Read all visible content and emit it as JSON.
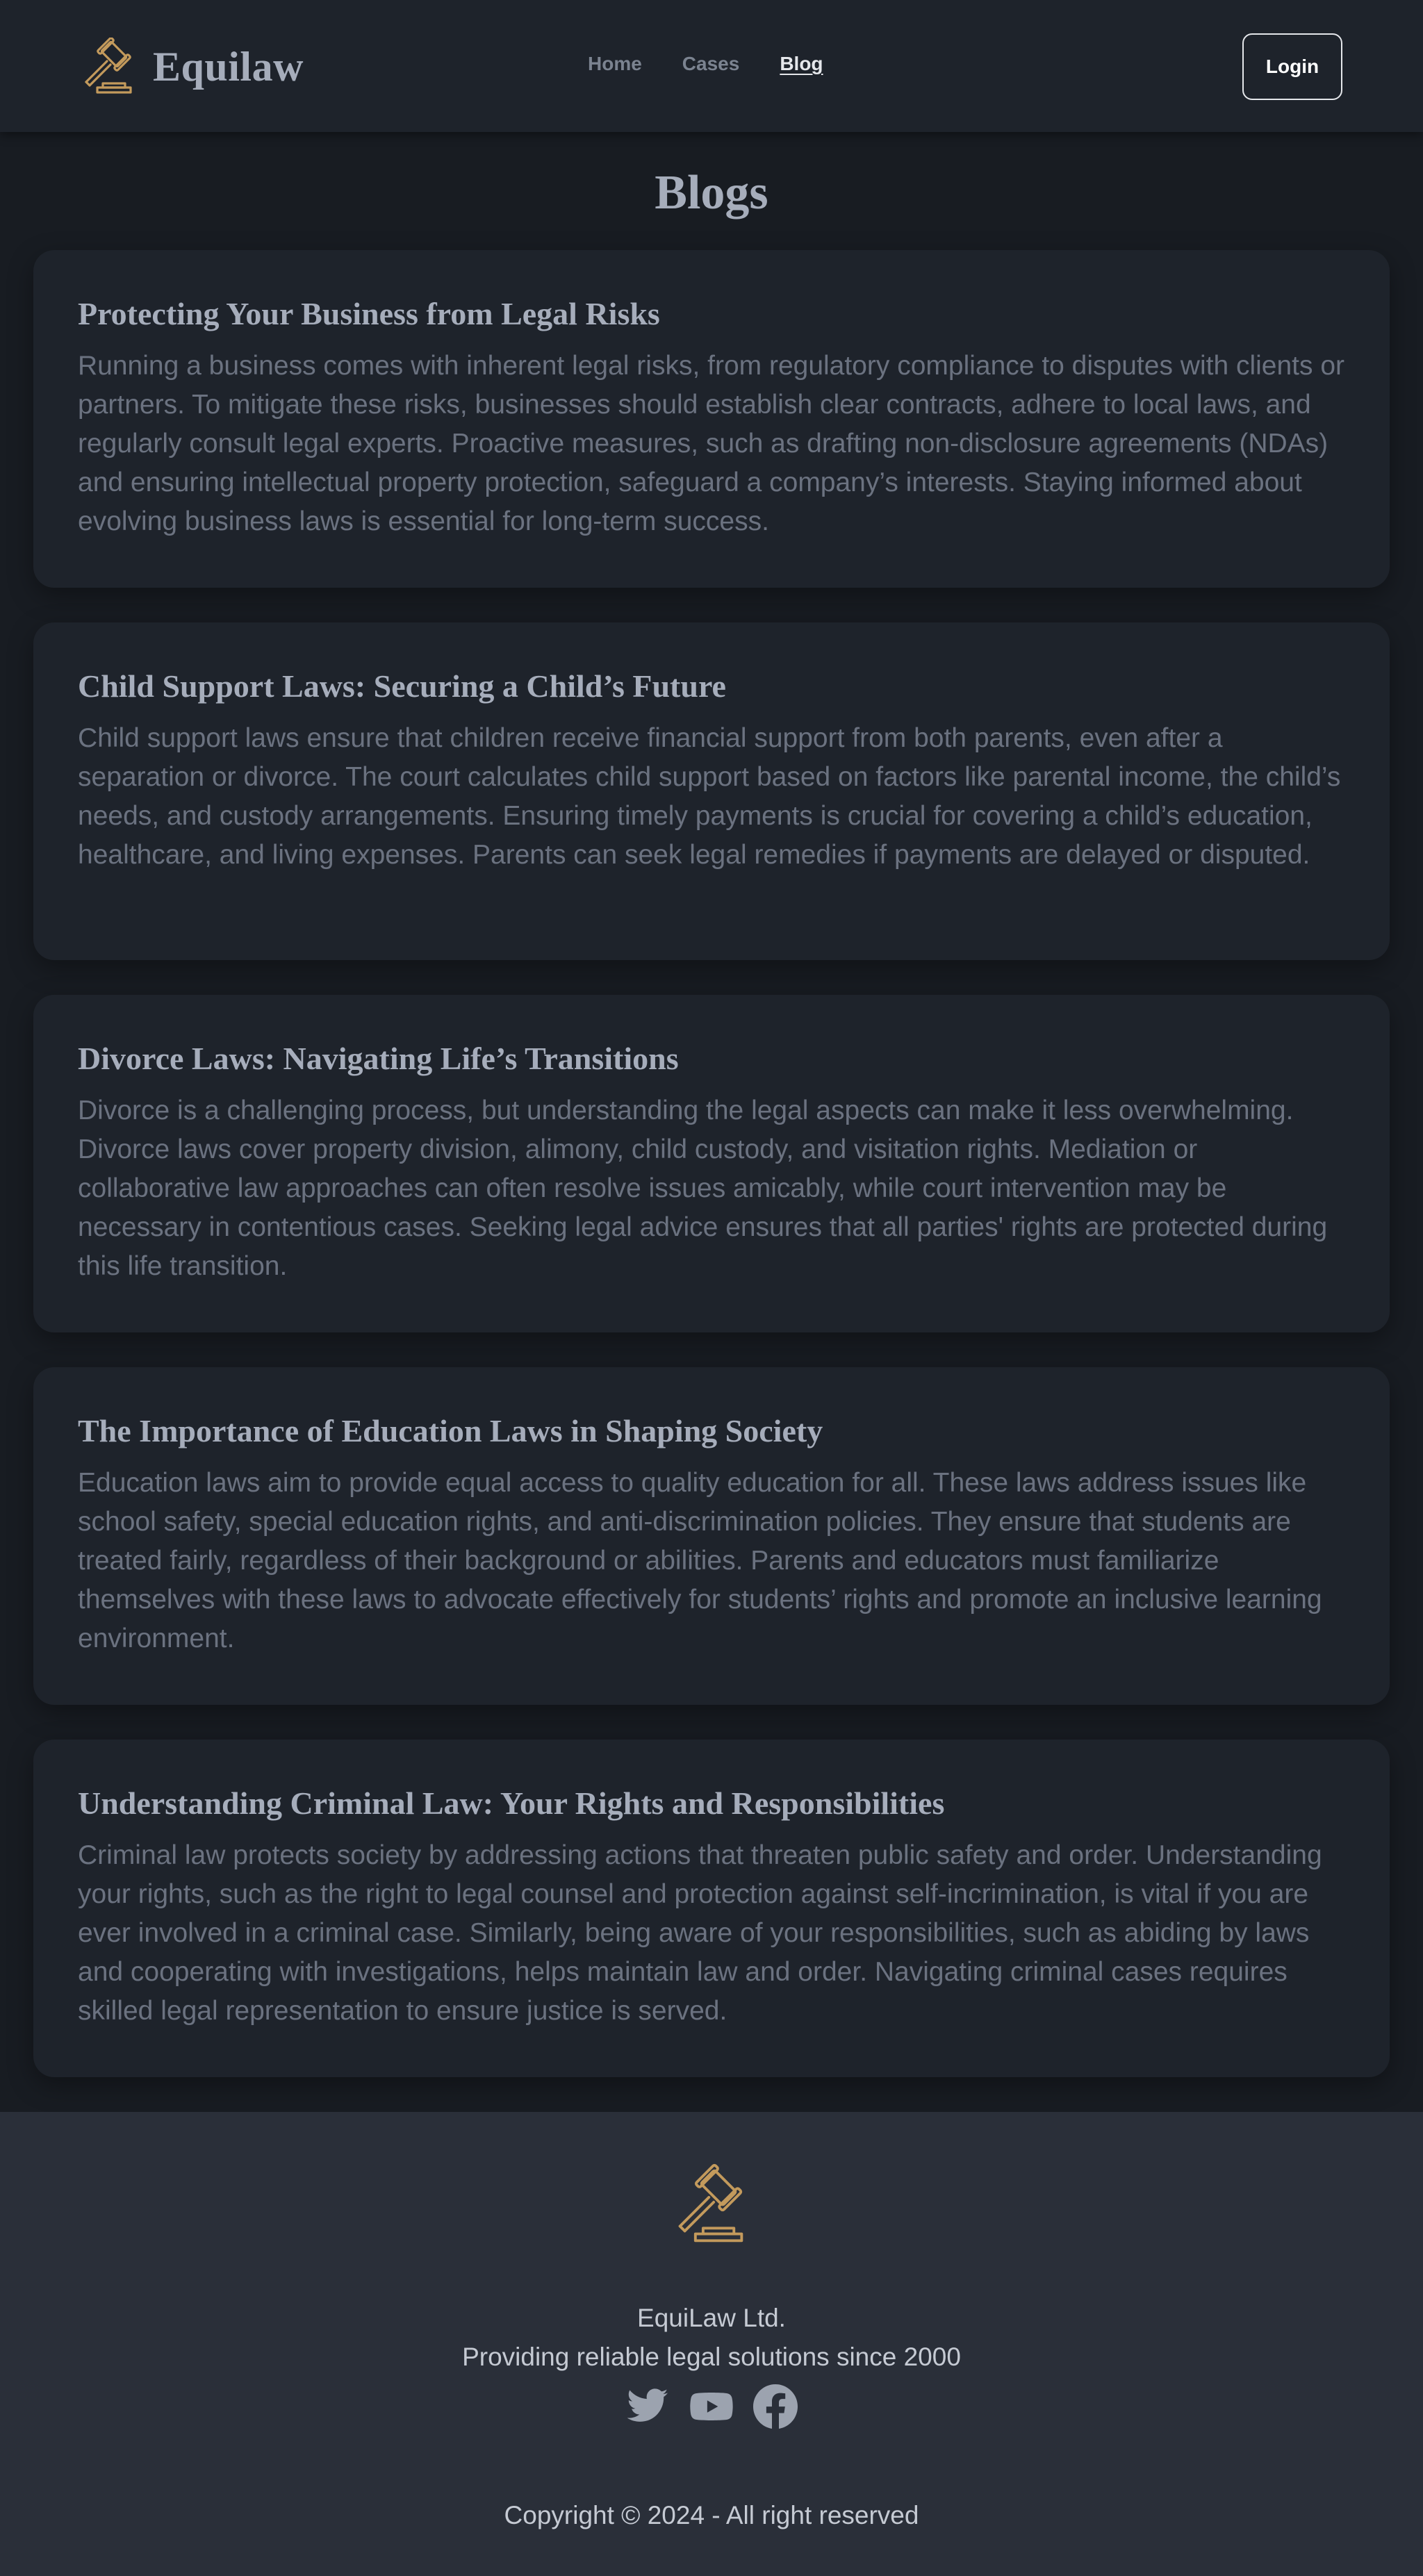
{
  "header": {
    "brand_name": "Equilaw",
    "logo_icon": "gavel-icon",
    "nav": [
      {
        "label": "Home",
        "active": false
      },
      {
        "label": "Cases",
        "active": false
      },
      {
        "label": "Blog",
        "active": true
      }
    ],
    "login_label": "Login"
  },
  "main": {
    "title": "Blogs",
    "posts": [
      {
        "title": "Protecting Your Business from Legal Risks",
        "body": "Running a business comes with inherent legal risks, from regulatory compliance to disputes with clients or partners. To mitigate these risks, businesses should establish clear contracts, adhere to local laws, and regularly consult legal experts. Proactive measures, such as drafting non-disclosure agreements (NDAs) and ensuring intellectual property protection, safeguard a company’s interests. Staying informed about evolving business laws is essential for long-term success."
      },
      {
        "title": "Child Support Laws: Securing a Child’s Future",
        "body": "Child support laws ensure that children receive financial support from both parents, even after a separation or divorce. The court calculates child support based on factors like parental income, the child’s needs, and custody arrangements. Ensuring timely payments is crucial for covering a child’s education, healthcare, and living expenses. Parents can seek legal remedies if payments are delayed or disputed."
      },
      {
        "title": "Divorce Laws: Navigating Life’s Transitions",
        "body": "Divorce is a challenging process, but understanding the legal aspects can make it less overwhelming. Divorce laws cover property division, alimony, child custody, and visitation rights. Mediation or collaborative law approaches can often resolve issues amicably, while court intervention may be necessary in contentious cases. Seeking legal advice ensures that all parties' rights are protected during this life transition."
      },
      {
        "title": "The Importance of Education Laws in Shaping Society",
        "body": "Education laws aim to provide equal access to quality education for all. These laws address issues like school safety, special education rights, and anti-discrimination policies. They ensure that students are treated fairly, regardless of their background or abilities. Parents and educators must familiarize themselves with these laws to advocate effectively for students’ rights and promote an inclusive learning environment."
      },
      {
        "title": "Understanding Criminal Law: Your Rights and Responsibilities",
        "body": "Criminal law protects society by addressing actions that threaten public safety and order. Understanding your rights, such as the right to legal counsel and protection against self-incrimination, is vital if you are ever involved in a criminal case. Similarly, being aware of your responsibilities, such as abiding by laws and cooperating with investigations, helps maintain law and order. Navigating criminal cases requires skilled legal representation to ensure justice is served."
      }
    ]
  },
  "footer": {
    "logo_icon": "gavel-icon",
    "company": "EquiLaw Ltd.",
    "tagline": "Providing reliable legal solutions since 2000",
    "social": [
      "twitter-icon",
      "youtube-icon",
      "facebook-icon"
    ],
    "copyright": "Copyright © 2024 - All right reserved"
  },
  "colors": {
    "background": "#181c22",
    "surface": "#1e232b",
    "footer": "#2a2f39",
    "accent_gold": "#c39a5c",
    "heading": "#a6adbb",
    "body_text": "#6b7280"
  }
}
